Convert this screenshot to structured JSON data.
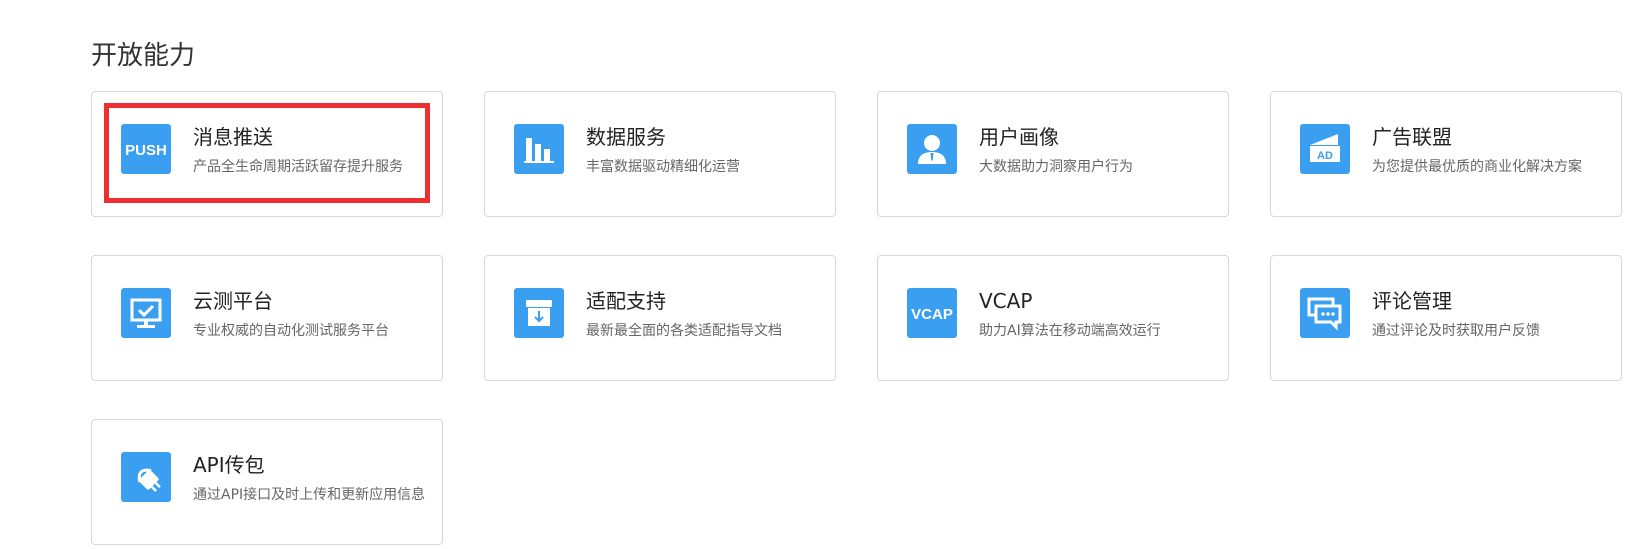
{
  "section": {
    "title": "开放能力"
  },
  "cards": [
    {
      "title": "消息推送",
      "desc": "产品全生命周期活跃留存提升服务",
      "icon": "push-icon",
      "icon_text": "PUSH",
      "highlighted": true
    },
    {
      "title": "数据服务",
      "desc": "丰富数据驱动精细化运营",
      "icon": "bar-chart-icon"
    },
    {
      "title": "用户画像",
      "desc": "大数据助力洞察用户行为",
      "icon": "user-profile-icon"
    },
    {
      "title": "广告联盟",
      "desc": "为您提供最优质的商业化解决方案",
      "icon": "ad-icon",
      "icon_text": "AD"
    },
    {
      "title": "云测平台",
      "desc": "专业权威的自动化测试服务平台",
      "icon": "monitor-check-icon"
    },
    {
      "title": "适配支持",
      "desc": "最新最全面的各类适配指导文档",
      "icon": "download-box-icon"
    },
    {
      "title": "VCAP",
      "desc": "助力AI算法在移动端高效运行",
      "icon": "vcap-icon",
      "icon_text": "VCAP"
    },
    {
      "title": "评论管理",
      "desc": "通过评论及时获取用户反馈",
      "icon": "comments-icon"
    },
    {
      "title": "API传包",
      "desc": "通过API接口及时上传和更新应用信息",
      "icon": "plug-icon"
    }
  ],
  "colors": {
    "icon_bg": "#3a9ff0",
    "highlight": "#ef2f2f",
    "card_border": "#d9d9d9"
  }
}
